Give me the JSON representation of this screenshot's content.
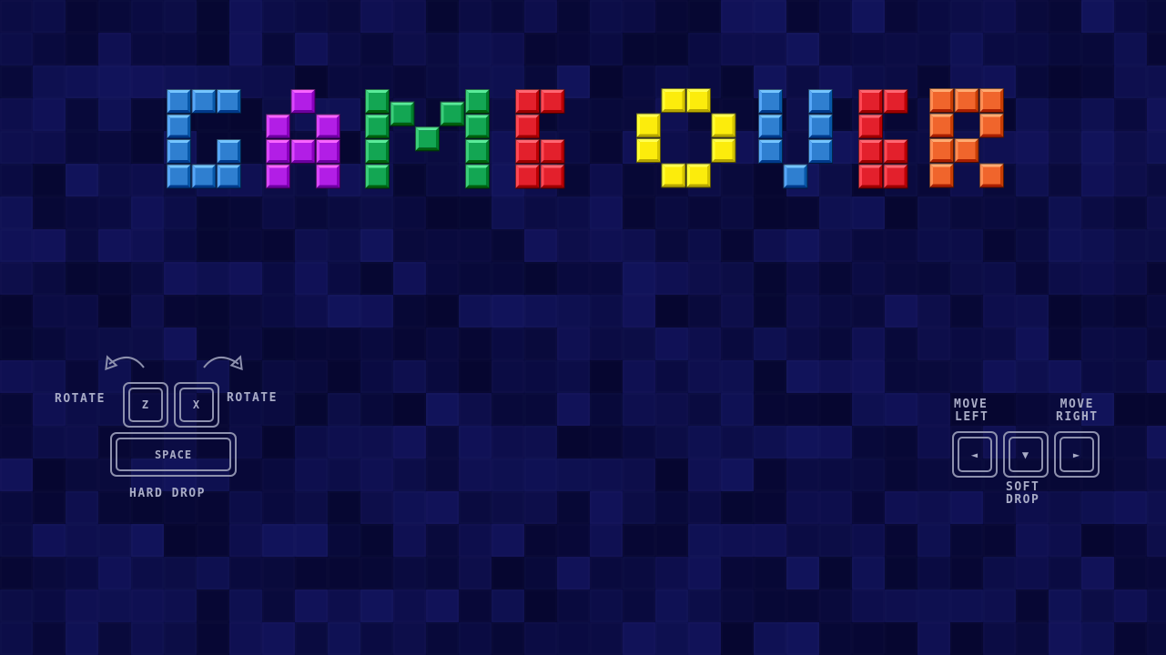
{
  "title": {
    "text": "GAME OVER",
    "letter_colors": [
      "#2f7fd0",
      "#b21ee6",
      "#13a653",
      "#e3202c",
      "#fcec0c",
      "#2f7fd0",
      "#e3202c",
      "#f0652c"
    ]
  },
  "controls_left": {
    "rotate_left_label": "ROTATE",
    "rotate_right_label": "ROTATE",
    "key_z": "Z",
    "key_x": "X",
    "key_space": "SPACE",
    "hard_drop_label": "HARD DROP"
  },
  "controls_right": {
    "move_left_label_1": "MOVE",
    "move_left_label_2": "LEFT",
    "move_right_label_1": "MOVE",
    "move_right_label_2": "RIGHT",
    "key_left": "◄",
    "key_down": "▼",
    "key_right": "►",
    "soft_drop_label_1": "SOFT",
    "soft_drop_label_2": "DROP"
  },
  "theme": {
    "background": "#0a0d3a",
    "control_color": "#a9acc6"
  }
}
